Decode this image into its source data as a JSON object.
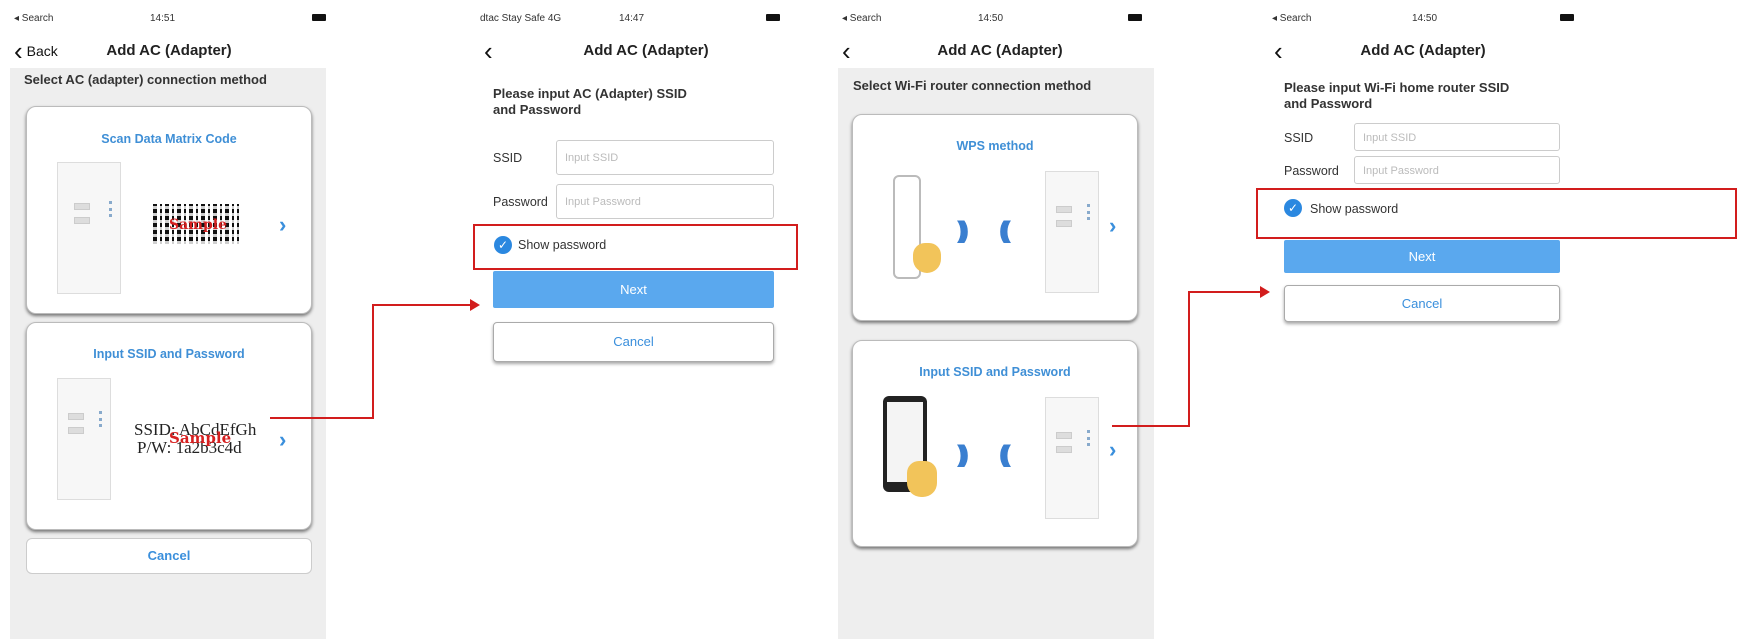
{
  "screen1": {
    "status": {
      "left": "◂ Search",
      "time": "14:51"
    },
    "nav": {
      "back_label": "Back",
      "title": "Add AC (Adapter)"
    },
    "heading": "Select AC (adapter) connection method",
    "card1": {
      "title": "Scan Data Matrix Code",
      "sample": "Sample"
    },
    "card2": {
      "title": "Input SSID and Password",
      "ssid_line": "SSID: AbCdEfGh",
      "pw_line": "P/W: 1a2b3c4d",
      "sample": "Sample"
    },
    "cancel": "Cancel"
  },
  "screen2": {
    "status": {
      "left": "dtac Stay Safe 4G",
      "time": "14:47"
    },
    "nav": {
      "title": "Add AC (Adapter)"
    },
    "prompt": "Please input AC (Adapter) SSID and Password",
    "ssid_label": "SSID",
    "ssid_placeholder": "Input SSID",
    "password_label": "Password",
    "password_placeholder": "Input Password",
    "show_password": "Show password",
    "next": "Next",
    "cancel": "Cancel"
  },
  "screen3": {
    "status": {
      "left": "◂ Search",
      "time": "14:50"
    },
    "nav": {
      "title": "Add AC (Adapter)"
    },
    "heading": "Select Wi-Fi router connection method",
    "card1": {
      "title": "WPS method"
    },
    "card2": {
      "title": "Input SSID and Password"
    }
  },
  "screen4": {
    "status": {
      "left": "◂ Search",
      "time": "14:50"
    },
    "nav": {
      "title": "Add AC (Adapter)"
    },
    "prompt": "Please input Wi-Fi home router SSID and Password",
    "ssid_label": "SSID",
    "ssid_placeholder": "Input SSID",
    "password_label": "Password",
    "password_placeholder": "Input Password",
    "show_password": "Show password",
    "next": "Next",
    "cancel": "Cancel"
  },
  "colors": {
    "accent": "#3a8fdc",
    "highlight": "#d21d1d",
    "next_button": "#5aa8ee"
  },
  "icons": [
    "chevron-left-icon",
    "chevron-right-icon",
    "checkmark-circle-icon",
    "battery-icon",
    "router-icon",
    "wifi-waves-icon",
    "hand-icon",
    "phone-icon",
    "adapter-device-icon",
    "data-matrix-code"
  ]
}
